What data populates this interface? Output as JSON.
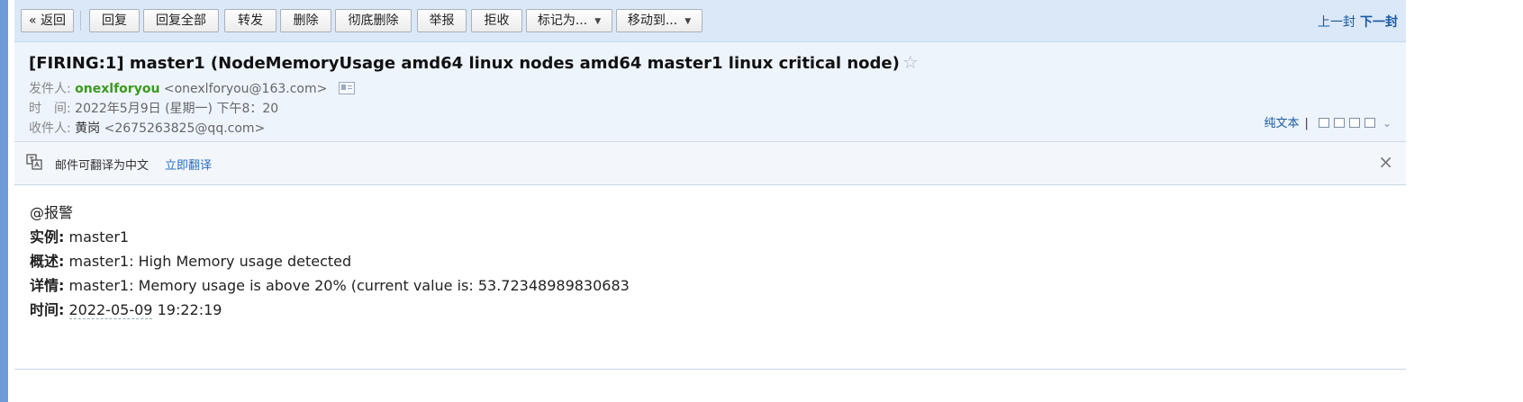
{
  "toolbar": {
    "back_label": "« 返回",
    "reply_label": "回复",
    "reply_all_label": "回复全部",
    "forward_label": "转发",
    "delete_label": "删除",
    "delete_permanently_label": "彻底删除",
    "report_label": "举报",
    "reject_label": "拒收",
    "mark_as_label": "标记为...",
    "move_to_label": "移动到...",
    "prev_label": "上一封",
    "next_label": "下一封"
  },
  "header": {
    "subject": "[FIRING:1] master1 (NodeMemoryUsage amd64 linux nodes amd64 master1 linux critical node)",
    "sender_label": "发件人:",
    "sender_name": "onexlforyou",
    "sender_email": "<onexlforyou@163.com>",
    "time_label": "时　间:",
    "time_value": "2022年5月9日 (星期一) 下午8：20",
    "recipient_label": "收件人:",
    "recipient_name": "黄岗",
    "recipient_email": "<2675263825@qq.com>",
    "plain_text_label": "纯文本",
    "separator": "|"
  },
  "translate_bar": {
    "message": "邮件可翻译为中文",
    "action": "立即翻译"
  },
  "body": {
    "mention": "@报警",
    "instance_label": "实例:",
    "instance_value": "master1",
    "summary_label": "概述:",
    "summary_value": "master1: High Memory usage detected",
    "details_label": "详情:",
    "details_value": "master1: Memory usage is above 20% (current value is: 53.72348989830683",
    "time_label": "时间:",
    "time_date": "2022-05-09",
    "time_clock": "19:22:19"
  },
  "icons": {
    "star": "star-icon",
    "contact": "contact-card-icon",
    "translate": "translate-icon",
    "close": "close-icon"
  },
  "colors": {
    "toolbar_bg": "#dbe8f7",
    "header_bg": "#edf4fc",
    "sender_name": "#3a9a1c",
    "link": "#1a5aa0",
    "left_accent": "#6f9ad8"
  }
}
